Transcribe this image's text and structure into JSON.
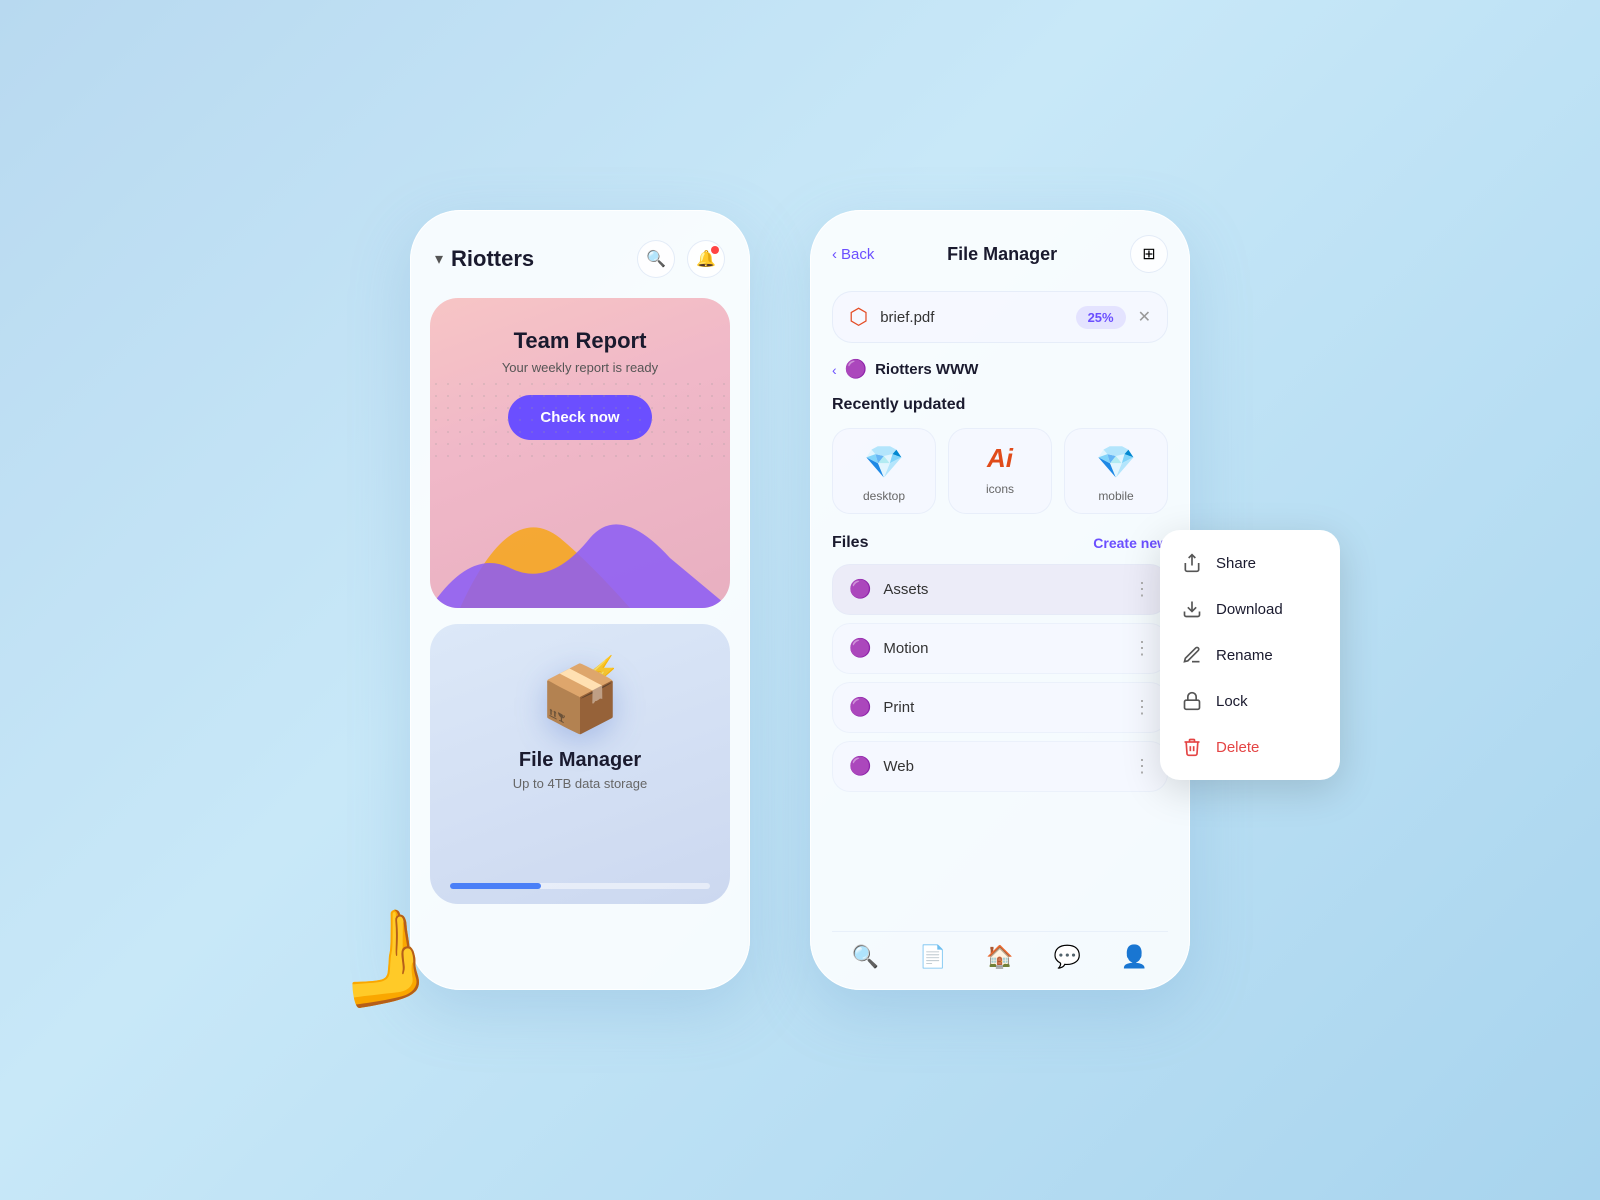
{
  "background": "#b8d9f0",
  "leftPhone": {
    "title": "Riotters",
    "teamReport": {
      "title": "Team Report",
      "subtitle": "Your weekly report is ready",
      "checkNowLabel": "Check now"
    },
    "fileManager": {
      "title": "File Manager",
      "subtitle": "Up to 4TB data storage"
    }
  },
  "rightPhone": {
    "header": {
      "backLabel": "Back",
      "title": "File Manager",
      "filterIcon": "filter-icon"
    },
    "pdfBar": {
      "filename": "brief.pdf",
      "percent": "25%",
      "closeLabel": "×"
    },
    "breadcrumb": {
      "folderName": "Riotters WWW"
    },
    "recentlyUpdated": {
      "label": "Recently updated",
      "items": [
        {
          "icon": "💎",
          "label": "desktop"
        },
        {
          "icon": "Ai",
          "label": "icons"
        },
        {
          "icon": "💎",
          "label": "mobile"
        }
      ]
    },
    "files": {
      "sectionLabel": "Files",
      "createNewLabel": "Create new",
      "items": [
        {
          "name": "Assets",
          "icon": "🟣"
        },
        {
          "name": "Motion",
          "icon": "🟣"
        },
        {
          "name": "Print",
          "icon": "🟣"
        },
        {
          "name": "Web",
          "icon": "🟣"
        }
      ]
    },
    "contextMenu": {
      "items": [
        {
          "label": "Share",
          "icon": "share"
        },
        {
          "label": "Download",
          "icon": "download"
        },
        {
          "label": "Rename",
          "icon": "rename"
        },
        {
          "label": "Lock",
          "icon": "lock"
        },
        {
          "label": "Delete",
          "icon": "delete",
          "isDelete": true
        }
      ]
    },
    "bottomNav": [
      {
        "icon": "🔍",
        "label": "search"
      },
      {
        "icon": "📄",
        "label": "files",
        "active": true
      },
      {
        "icon": "🏠",
        "label": "home"
      },
      {
        "icon": "💬",
        "label": "messages"
      },
      {
        "icon": "👤",
        "label": "profile"
      }
    ]
  }
}
